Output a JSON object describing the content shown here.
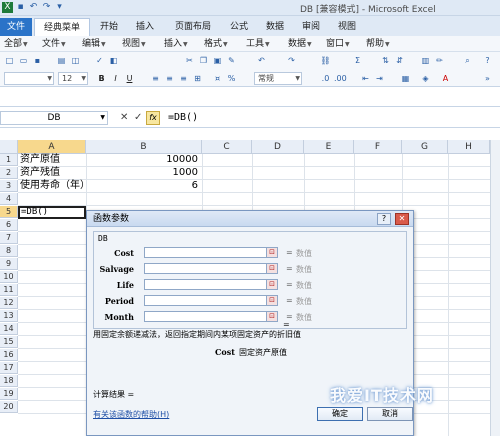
{
  "window": {
    "title": "DB [兼容模式] - Microsoft Excel"
  },
  "ribbon_tabs": [
    "文件",
    "经典菜单",
    "开始",
    "插入",
    "页面布局",
    "公式",
    "数据",
    "审阅",
    "视图"
  ],
  "menus": [
    "全部",
    "文件",
    "编辑",
    "视图",
    "插入",
    "格式",
    "工具",
    "数据",
    "窗口",
    "帮助"
  ],
  "toolbar": {
    "font_size": "12",
    "number_format": "常规"
  },
  "formula_bar": {
    "name_box": "DB",
    "content": "=DB()",
    "fx": "fx",
    "cancel": "✕",
    "confirm": "✓"
  },
  "grid": {
    "columns": [
      "A",
      "B",
      "C",
      "D",
      "E",
      "F",
      "G",
      "H"
    ],
    "rows": [
      "1",
      "2",
      "3",
      "4",
      "5",
      "6",
      "7",
      "8",
      "9",
      "10",
      "11",
      "12",
      "13",
      "14",
      "15",
      "16",
      "17",
      "18",
      "19",
      "20"
    ],
    "cells": {
      "A1": "资产原值",
      "B1": "10000",
      "A2": "资产残值",
      "B2": "1000",
      "A3": "使用寿命（年）",
      "B3": "6",
      "A5": "=DB()"
    }
  },
  "dialog": {
    "title": "函数参数",
    "help_btn": "?",
    "close_btn": "✕",
    "function_name": "DB",
    "args": [
      {
        "name": "Cost",
        "eq": "=",
        "value": "数值"
      },
      {
        "name": "Salvage",
        "eq": "=",
        "value": "数值"
      },
      {
        "name": "Life",
        "eq": "=",
        "value": "数值"
      },
      {
        "name": "Period",
        "eq": "=",
        "value": "数值"
      },
      {
        "name": "Month",
        "eq": "=",
        "value": "数值"
      }
    ],
    "result_eq": "=",
    "description": "用固定余额递减法，返回指定期间内某项固定资产的折旧值",
    "arg_desc_name": "Cost",
    "arg_desc": "固定资产原值",
    "calc_result": "计算结果 =",
    "help_link": "有关该函数的帮助(H)",
    "ok": "确定",
    "cancel": "取消"
  },
  "watermark": "我爱IT技术网"
}
